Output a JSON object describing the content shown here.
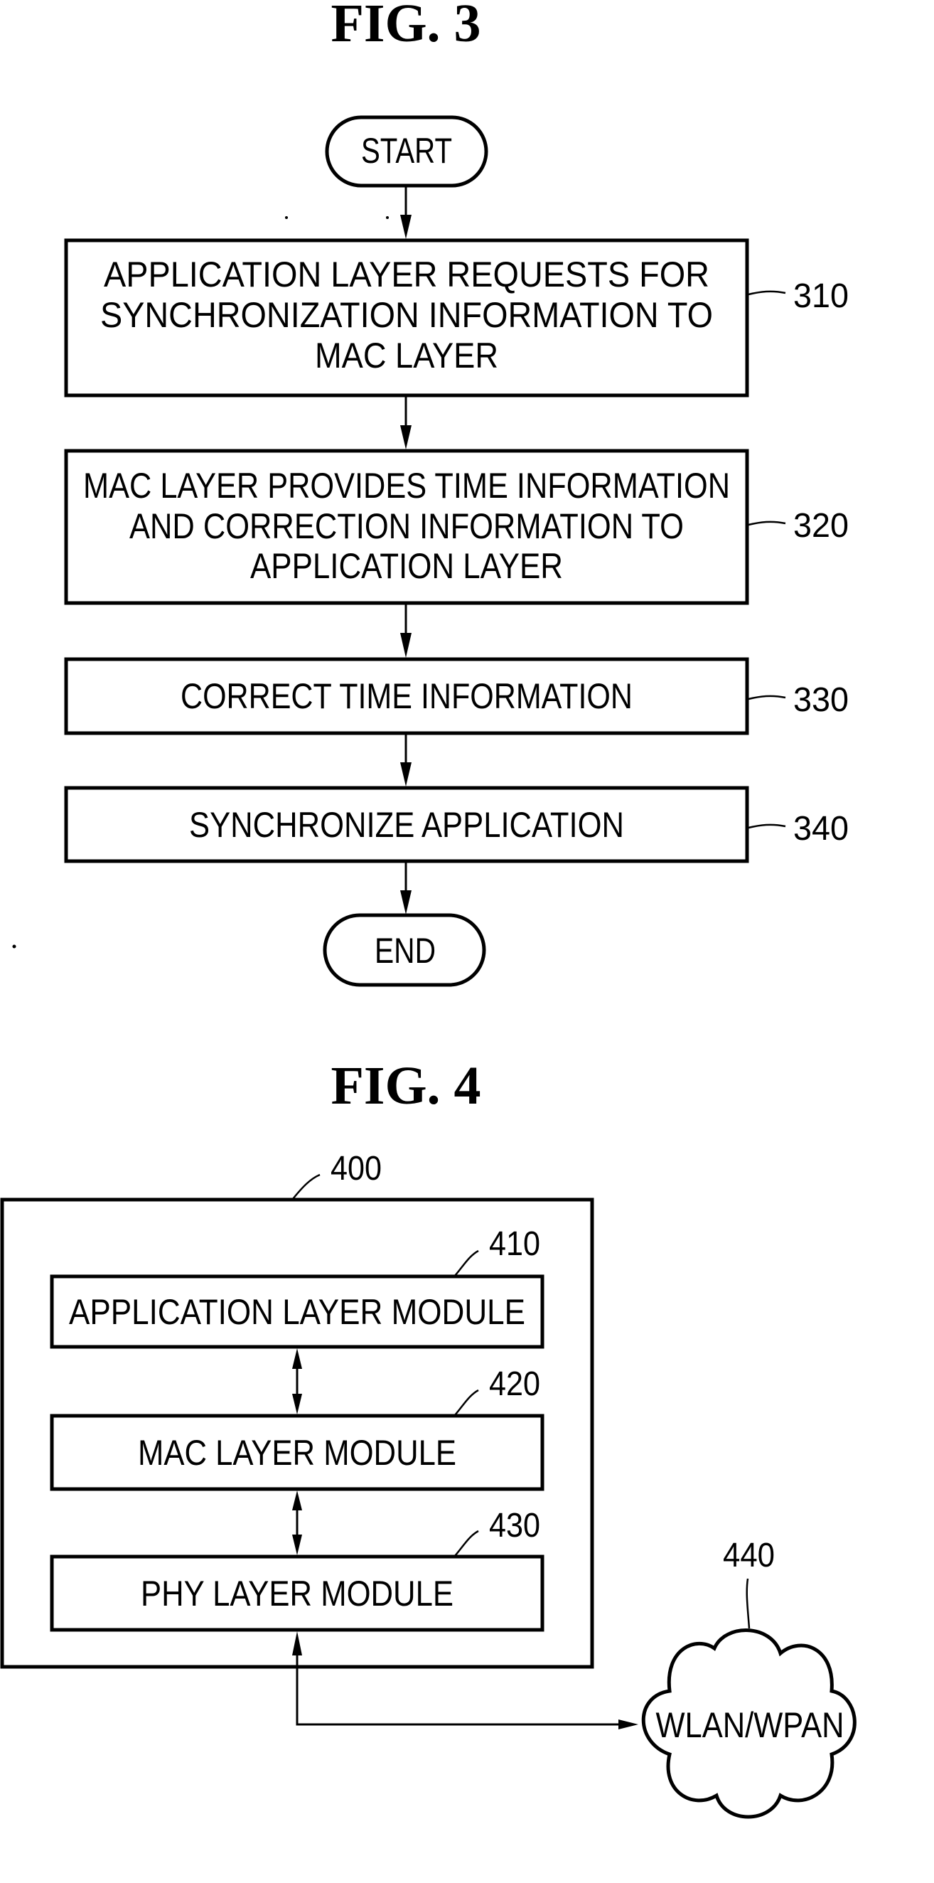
{
  "fig3": {
    "title": "FIG. 3",
    "start": "START",
    "end": "END",
    "steps": [
      {
        "ref": "310",
        "lines": [
          "APPLICATION LAYER REQUESTS FOR",
          "SYNCHRONIZATION INFORMATION TO",
          "MAC LAYER"
        ]
      },
      {
        "ref": "320",
        "lines": [
          "MAC LAYER PROVIDES TIME INFORMATION",
          "AND CORRECTION INFORMATION TO",
          "APPLICATION LAYER"
        ]
      },
      {
        "ref": "330",
        "lines": [
          "CORRECT TIME INFORMATION"
        ]
      },
      {
        "ref": "340",
        "lines": [
          "SYNCHRONIZE APPLICATION"
        ]
      }
    ]
  },
  "fig4": {
    "title": "FIG. 4",
    "device": {
      "ref": "400"
    },
    "modules": [
      {
        "ref": "410",
        "label": "APPLICATION LAYER MODULE"
      },
      {
        "ref": "420",
        "label": "MAC LAYER MODULE"
      },
      {
        "ref": "430",
        "label": "PHY LAYER MODULE"
      }
    ],
    "network": {
      "ref": "440",
      "label": "WLAN/WPAN"
    }
  }
}
